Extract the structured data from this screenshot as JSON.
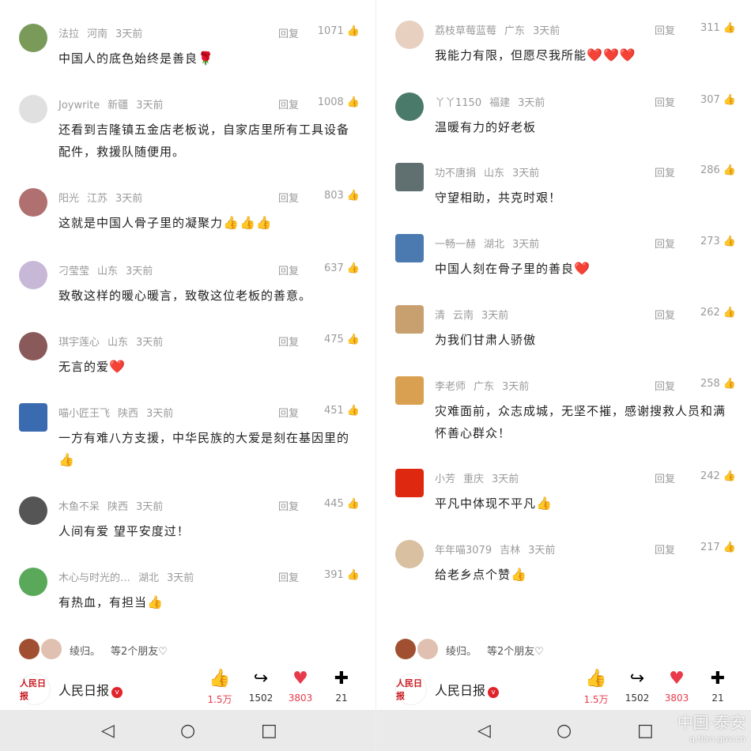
{
  "left": {
    "comments": [
      {
        "user": "法拉",
        "region": "河南",
        "time": "3天前",
        "reply": "回复",
        "likes": "1071",
        "text": "中国人的底色始终是善良",
        "emoji": "🌹"
      },
      {
        "user": "Joywrite",
        "region": "新疆",
        "time": "3天前",
        "reply": "回复",
        "likes": "1008",
        "text": "还看到吉隆镇五金店老板说，自家店里所有工具设备配件，救援队随便用。",
        "emoji": ""
      },
      {
        "user": "阳光",
        "region": "江苏",
        "time": "3天前",
        "reply": "回复",
        "likes": "803",
        "text": "这就是中国人骨子里的凝聚力",
        "emoji": "👍👍👍"
      },
      {
        "user": "刁莹莹",
        "region": "山东",
        "time": "3天前",
        "reply": "回复",
        "likes": "637",
        "text": "致敬这样的暖心暖言，致敬这位老板的善意。",
        "emoji": ""
      },
      {
        "user": "琪宇莲心",
        "region": "山东",
        "time": "3天前",
        "reply": "回复",
        "likes": "475",
        "text": "无言的爱",
        "emoji": "❤️"
      },
      {
        "user": "喵小匠王飞",
        "region": "陕西",
        "time": "3天前",
        "reply": "回复",
        "likes": "451",
        "text": "一方有难八方支援，中华民族的大爱是刻在基因里的",
        "emoji": "👍"
      },
      {
        "user": "木鱼不呆",
        "region": "陕西",
        "time": "3天前",
        "reply": "回复",
        "likes": "445",
        "text": "人间有爱 望平安度过！",
        "emoji": ""
      },
      {
        "user": "木心与时光的…",
        "region": "湖北",
        "time": "3天前",
        "reply": "回复",
        "likes": "391",
        "text": "有热血，有担当",
        "emoji": "👍"
      }
    ],
    "friends": {
      "name": "绫归。",
      "suffix": "等2个朋友♡"
    },
    "outlet": "人民日报",
    "actions": {
      "like": "1.5万",
      "share": "1502",
      "heart": "3803",
      "comment": "21"
    }
  },
  "right": {
    "comments": [
      {
        "user": "荔枝草莓蓝莓",
        "region": "广东",
        "time": "3天前",
        "reply": "回复",
        "likes": "311",
        "text": "我能力有限，但愿尽我所能",
        "emoji": "❤️❤️❤️"
      },
      {
        "user": "丫丫1150",
        "region": "福建",
        "time": "3天前",
        "reply": "回复",
        "likes": "307",
        "text": "温暖有力的好老板",
        "emoji": ""
      },
      {
        "user": "功不唐捐",
        "region": "山东",
        "time": "3天前",
        "reply": "回复",
        "likes": "286",
        "text": "守望相助，共克时艰！",
        "emoji": ""
      },
      {
        "user": "一畅一赫",
        "region": "湖北",
        "time": "3天前",
        "reply": "回复",
        "likes": "273",
        "text": "中国人刻在骨子里的善良",
        "emoji": "❤️"
      },
      {
        "user": "清",
        "region": "云南",
        "time": "3天前",
        "reply": "回复",
        "likes": "262",
        "text": "为我们甘肃人骄傲",
        "emoji": ""
      },
      {
        "user": "李老师",
        "region": "广东",
        "time": "3天前",
        "reply": "回复",
        "likes": "258",
        "text": "灾难面前，众志成城，无坚不摧，感谢搜救人员和满怀善心群众！",
        "emoji": ""
      },
      {
        "user": "小芳",
        "region": "重庆",
        "time": "3天前",
        "reply": "回复",
        "likes": "242",
        "text": "平凡中体现不平凡",
        "emoji": "👍"
      },
      {
        "user": "年年喵3079",
        "region": "吉林",
        "time": "3天前",
        "reply": "回复",
        "likes": "217",
        "text": "给老乡点个赞",
        "emoji": "👍"
      }
    ],
    "friends": {
      "name": "绫归。",
      "suffix": "等2个朋友♡"
    },
    "outlet": "人民日报",
    "actions": {
      "like": "1.5万",
      "share": "1502",
      "heart": "3803",
      "comment": "21"
    }
  },
  "watermark": "中国·泰安",
  "watermark_url": "q.tian.gov.cn",
  "logo_text": "人民日报"
}
